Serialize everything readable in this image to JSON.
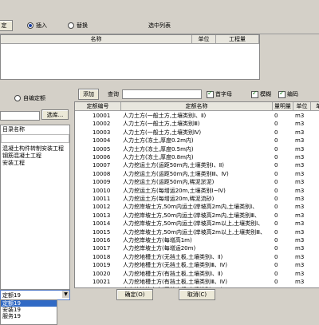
{
  "top": {
    "confirm_btn": "定",
    "radio_insert": "插入",
    "radio_replace": "替换",
    "selected_list_label": "选中列表",
    "columns": [
      "名称",
      "单位",
      "工程量"
    ]
  },
  "left": {
    "radio_custom": "自编定额",
    "select_btn": "选库...",
    "header_label": "目录名称",
    "tree_items": [
      "混凝土构件转制安装工程",
      "钢筋混凝土工程",
      "安装工程"
    ],
    "dropdown_options": [
      "定额19",
      "安装19",
      "服务19"
    ]
  },
  "right": {
    "add_btn": "添加",
    "query_label": "查询",
    "query_value": "",
    "opt_first_letter": "首字母",
    "opt_fuzzy": "模糊",
    "opt_code": "编码",
    "columns": [
      "定额编号",
      "定额名称",
      "量明量",
      "单位",
      "单"
    ],
    "rows": [
      [
        "10001",
        "人力土方(一般土方,土壤类别Ⅰ、Ⅱ)",
        "0",
        "m3"
      ],
      [
        "10002",
        "人力土方(一般土方,土壤类别Ⅲ)",
        "0",
        "m3"
      ],
      [
        "10003",
        "人力土方(一般土方,土壤类别Ⅳ)",
        "0",
        "m3"
      ],
      [
        "10004",
        "人力土方(冻土,厚度0.2m内)",
        "0",
        "m3"
      ],
      [
        "10005",
        "人力土方(冻土,厚度0.5m内)",
        "0",
        "m3"
      ],
      [
        "10006",
        "人力土方(冻土,厚度0.8m内)",
        "0",
        "m3"
      ],
      [
        "10007",
        "人力挖运土方(运距50m内,土壤类别Ⅰ、Ⅱ)",
        "0",
        "m3"
      ],
      [
        "10008",
        "人力挖运土方(运距50m内,土壤类别Ⅲ、Ⅳ)",
        "0",
        "m3"
      ],
      [
        "10009",
        "人力挖运土方(运距50m内,稀泥淤泥)",
        "0",
        "m3"
      ],
      [
        "10010",
        "人力挖运土方(每增运20m,土壤类别Ⅰ~Ⅳ)",
        "0",
        "m3"
      ],
      [
        "10011",
        "人力挖运土方(每增运20m,稀泥流砂)",
        "0",
        "m3"
      ],
      [
        "10012",
        "人力挖岸坡土方,50m内运土(岸坡高2m内,土壤类别Ⅰ、",
        "0",
        "m3"
      ],
      [
        "10013",
        "人力挖岸坡土方,50m内运土(岸坡高2m内,土壤类别Ⅲ、",
        "0",
        "m3"
      ],
      [
        "10014",
        "人力挖岸坡土方,50m内运土(岸坡高2m以上,土壤类别Ⅰ、",
        "0",
        "m3"
      ],
      [
        "10015",
        "人力挖岸坡土方,50m内运土(岸坡高2m以上,土壤类别Ⅲ、",
        "0",
        "m3"
      ],
      [
        "10016",
        "人力挖岸坡土方(每增高1m)",
        "0",
        "m3"
      ],
      [
        "10017",
        "人力挖岸坡土方(每增运20m)",
        "0",
        "m3"
      ],
      [
        "10018",
        "人力挖地槽土方(无挡土板,土壤类别Ⅰ、Ⅱ)",
        "0",
        "m3"
      ],
      [
        "10019",
        "人力挖地槽土方(无挡土板,土壤类别Ⅲ、Ⅳ)",
        "0",
        "m3"
      ],
      [
        "10020",
        "人力挖地槽土方(有挡土板,土壤类别Ⅰ、Ⅱ)",
        "0",
        "m3"
      ],
      [
        "10021",
        "人力挖地槽土方(有挡土板,土壤类别Ⅲ、Ⅳ)",
        "0",
        "m3"
      ],
      [
        "10022",
        "人力挖地坑土方(无挡土板,土壤类别Ⅰ、Ⅱ)",
        "0",
        "m3"
      ]
    ]
  },
  "bottom": {
    "ok_btn": "确定(O)",
    "cancel_btn": "取消(C)"
  }
}
